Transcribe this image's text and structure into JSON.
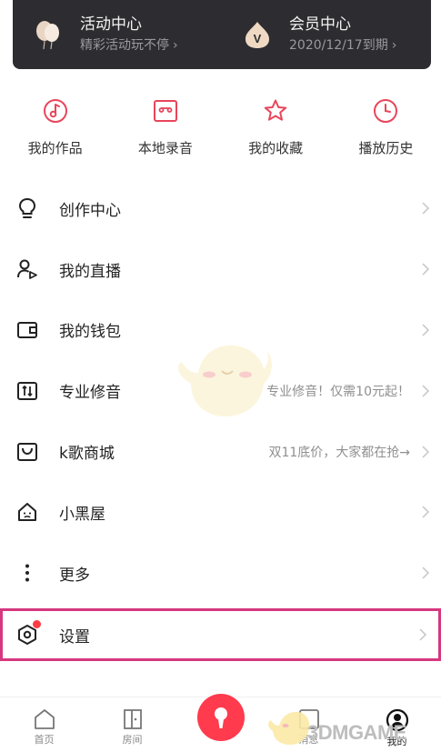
{
  "banner": {
    "activity": {
      "title": "活动中心",
      "subtitle": "精彩活动玩不停",
      "chevron": "›"
    },
    "vip": {
      "title": "会员中心",
      "subtitle": "2020/12/17到期",
      "chevron": "›"
    }
  },
  "shortcuts": [
    {
      "label": "我的作品",
      "icon": "music-note-icon"
    },
    {
      "label": "本地录音",
      "icon": "cassette-icon"
    },
    {
      "label": "我的收藏",
      "icon": "star-icon"
    },
    {
      "label": "播放历史",
      "icon": "clock-icon"
    }
  ],
  "menu": [
    {
      "label": "创作中心",
      "icon": "lightbulb-icon",
      "hint": ""
    },
    {
      "label": "我的直播",
      "icon": "live-user-icon",
      "hint": ""
    },
    {
      "label": "我的钱包",
      "icon": "wallet-icon",
      "hint": ""
    },
    {
      "label": "专业修音",
      "icon": "equalizer-icon",
      "hint": "专业修音！仅需10元起！"
    },
    {
      "label": "k歌商城",
      "icon": "shop-bag-icon",
      "hint": "双11底价，大家都在抢→"
    },
    {
      "label": "小黑屋",
      "icon": "house-icon",
      "hint": ""
    },
    {
      "label": "更多",
      "icon": "more-vertical-icon",
      "hint": ""
    }
  ],
  "settings": {
    "label": "设置",
    "icon": "settings-hex-icon"
  },
  "tabbar": {
    "tabs": [
      {
        "label": "首页",
        "icon": "home-icon"
      },
      {
        "label": "房间",
        "icon": "door-icon"
      },
      {
        "label": "",
        "icon": "microphone-icon"
      },
      {
        "label": "消息",
        "icon": "message-icon"
      },
      {
        "label": "我的",
        "icon": "profile-icon"
      }
    ]
  },
  "watermark": "3DMGAME",
  "colors": {
    "accent": "#e8455a",
    "banner_bg": "#2d2d31",
    "highlight": "#d6377e",
    "mic": "#ff3b4d"
  }
}
